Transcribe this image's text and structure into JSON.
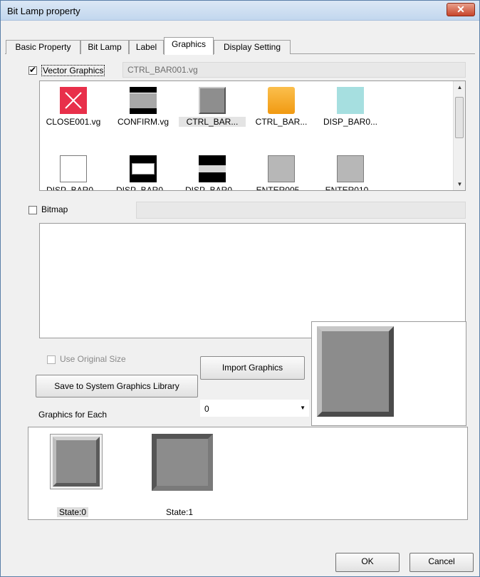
{
  "window": {
    "title": "Bit Lamp property",
    "close_glyph": "✕"
  },
  "tabs": [
    {
      "label": "Basic Property"
    },
    {
      "label": "Bit Lamp"
    },
    {
      "label": "Label"
    },
    {
      "label": "Graphics",
      "active": true
    },
    {
      "label": "Display Setting"
    }
  ],
  "vector_graphics": {
    "checked": true,
    "label": "Vector Graphics",
    "selected_file": "CTRL_BAR001.vg",
    "items_row1": [
      {
        "label": "CLOSE001.vg",
        "icon": "close-x-icon"
      },
      {
        "label": "CONFIRM.vg",
        "icon": "confirm-bar-icon"
      },
      {
        "label": "CTRL_BAR...",
        "icon": "ctrl-bar-gray-icon",
        "selected": true
      },
      {
        "label": "CTRL_BAR...",
        "icon": "ctrl-bar-orange-icon"
      },
      {
        "label": "DISP_BAR0...",
        "icon": "disp-bar-teal-icon"
      }
    ],
    "items_row2": [
      {
        "label": "DISP_BAR0...",
        "icon": "disp-bar-white-icon"
      },
      {
        "label": "DISP_BAR0...",
        "icon": "disp-bar-black-white-icon"
      },
      {
        "label": "DISP_BAR0...",
        "icon": "disp-bar-black-icon"
      },
      {
        "label": "ENTER005...",
        "icon": "enter-gray-icon"
      },
      {
        "label": "ENTER010...",
        "icon": "enter-gray-icon"
      }
    ]
  },
  "bitmap": {
    "checked": false,
    "label": "Bitmap",
    "file": ""
  },
  "use_original_size": {
    "checked": false,
    "label": "Use Original Size"
  },
  "buttons": {
    "import_graphics": "Import Graphics",
    "save_to_library": "Save to System Graphics Library",
    "ok": "OK",
    "cancel": "Cancel"
  },
  "graphics_for_each": {
    "label": "Graphics for Each",
    "value": "0"
  },
  "states": [
    {
      "label": "State:0",
      "selected": true
    },
    {
      "label": "State:1"
    }
  ],
  "colors": {
    "accent_red": "#e8304a",
    "gray_face": "#9a9a9a",
    "orange": "#f7a828",
    "teal": "#a6dfe0"
  }
}
